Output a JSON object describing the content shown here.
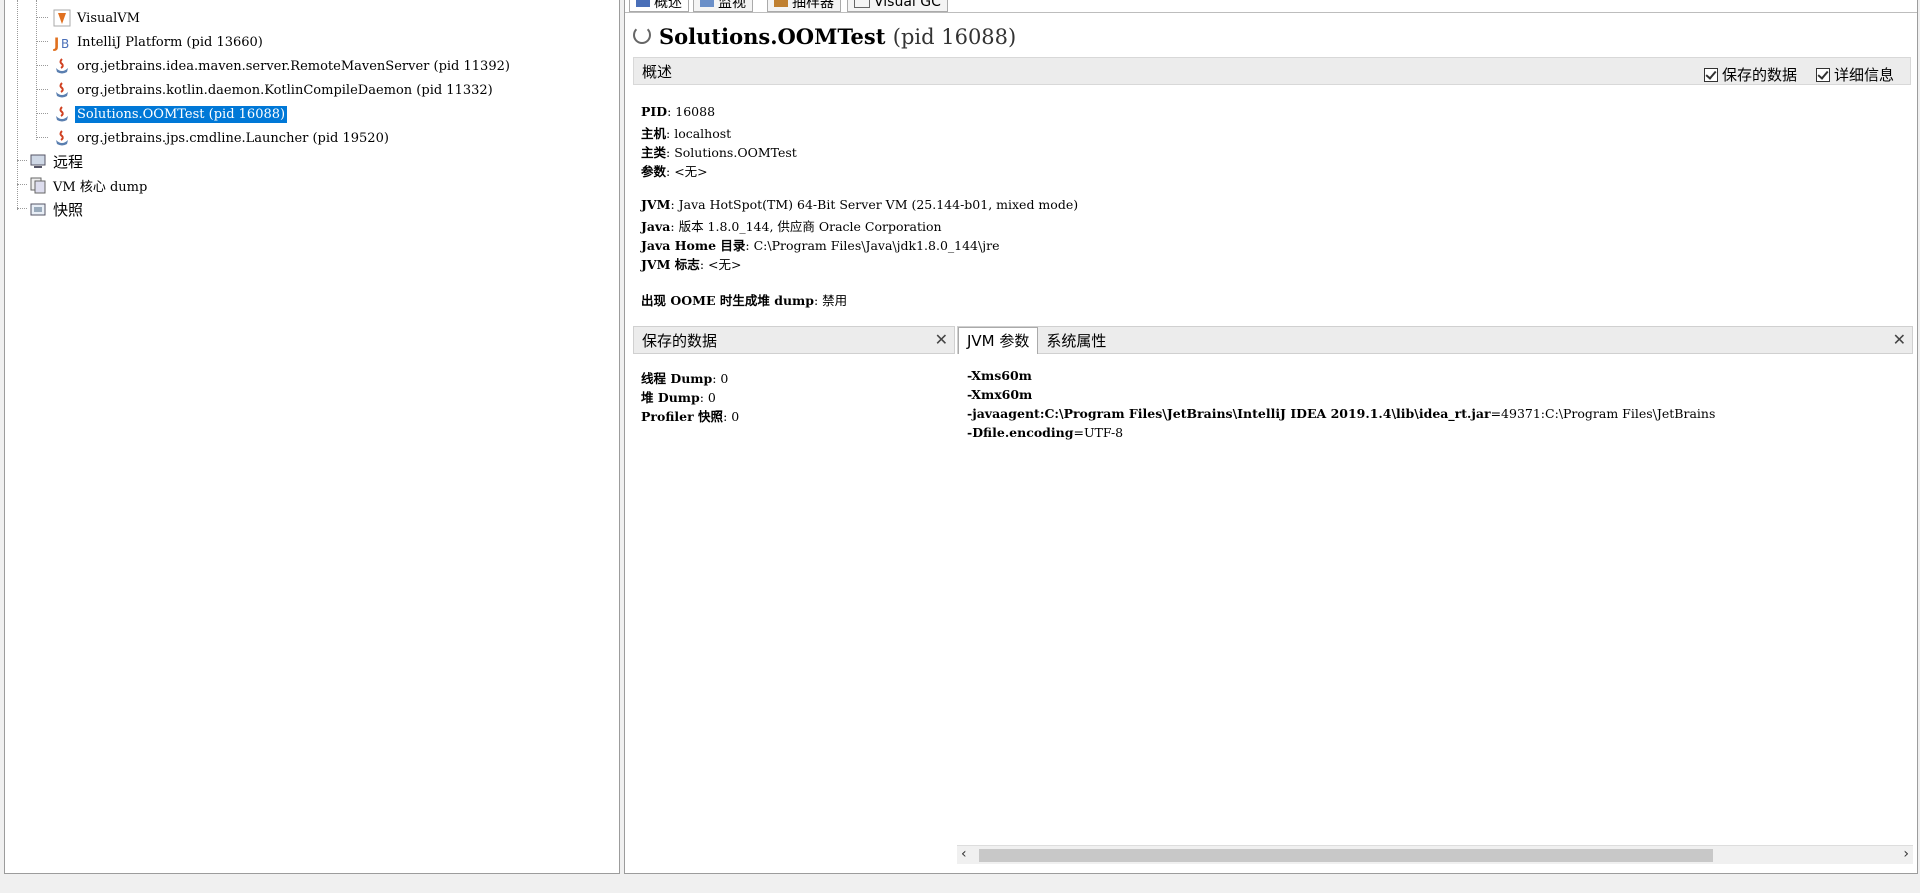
{
  "tree": {
    "items": [
      {
        "label": "VisualVM",
        "icon": "visualvm-icon"
      },
      {
        "label": "IntelliJ Platform (pid 13660)",
        "icon": "intellij-icon"
      },
      {
        "label": "org.jetbrains.idea.maven.server.RemoteMavenServer (pid 11392)",
        "icon": "java-icon"
      },
      {
        "label": "org.jetbrains.kotlin.daemon.KotlinCompileDaemon (pid 11332)",
        "icon": "java-icon"
      },
      {
        "label": "Solutions.OOMTest (pid 16088)",
        "icon": "java-icon"
      },
      {
        "label": "org.jetbrains.jps.cmdline.Launcher (pid 19520)",
        "icon": "java-icon"
      }
    ],
    "groups": [
      {
        "label": "远程",
        "icon": "remote-icon"
      },
      {
        "label": "VM 核心 dump",
        "icon": "coredump-icon"
      },
      {
        "label": "快照",
        "icon": "snapshot-icon"
      }
    ]
  },
  "top_tabs": [
    "概述",
    "监视",
    "抽样器",
    "Visual GC"
  ],
  "title": {
    "name": "Solutions.OOMTest",
    "pid": "(pid 16088)"
  },
  "overview": {
    "section_label": "概述",
    "check_saved": "保存的数据",
    "check_detail": "详细信息",
    "pid_key": "PID",
    "pid_val": ": 16088",
    "host_key": "主机",
    "host_val": ": localhost",
    "main_key": "主类",
    "main_val": ": Solutions.OOMTest",
    "args_key": "参数",
    "args_val": ": <无>",
    "jvm_key": "JVM",
    "jvm_val": ": Java HotSpot(TM) 64-Bit Server VM (25.144-b01, mixed mode)",
    "java_key": "Java",
    "java_val": ": 版本 1.8.0_144, 供应商 Oracle Corporation",
    "home_key": "Java Home 目录",
    "home_val": ": C:\\Program Files\\Java\\jdk1.8.0_144\\jre",
    "flags_key": "JVM 标志",
    "flags_val": ": <无>",
    "oome_key": "出现 OOME 时生成堆 dump",
    "oome_val": ": 禁用"
  },
  "saved": {
    "label": "保存的数据",
    "thread_key": "线程 Dump",
    "thread_val": ": 0",
    "heap_key": "堆 Dump",
    "heap_val": ": 0",
    "prof_key": "Profiler 快照",
    "prof_val": ": 0"
  },
  "jvmargs": {
    "tab_jvm": "JVM 参数",
    "tab_sys": "系统属性",
    "l1": "-Xms60m",
    "l2": "-Xmx60m",
    "l3a": "-javaagent:C:\\Program  Files\\JetBrains\\IntelliJ  IDEA  2019.1.4\\lib\\idea_rt.jar",
    "l3b": "=49371:C:\\Program  Files\\JetBrains",
    "l4a": "-Dfile.encoding",
    "l4b": "=UTF-8"
  }
}
